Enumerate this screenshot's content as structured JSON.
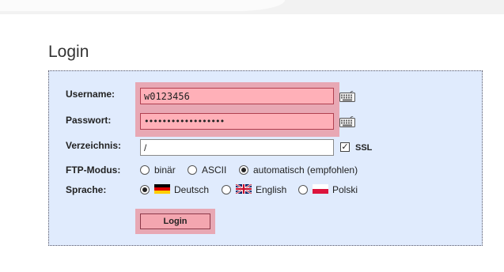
{
  "page": {
    "title": "Login"
  },
  "form": {
    "username_label": "Username:",
    "username_value": "w0123456",
    "password_label": "Passwort:",
    "password_value": "••••••••••••••••••",
    "directory_label": "Verzeichnis:",
    "directory_value": "/",
    "ssl_label": "SSL",
    "ssl_checked": "✓",
    "ftp_mode_label": "FTP-Modus:",
    "ftp_modes": [
      {
        "label": "binär",
        "selected": false
      },
      {
        "label": "ASCII",
        "selected": false
      },
      {
        "label": "automatisch (empfohlen)",
        "selected": true
      }
    ],
    "language_label": "Sprache:",
    "languages": [
      {
        "label": "Deutsch",
        "selected": true,
        "flag": "germany-flag-icon"
      },
      {
        "label": "English",
        "selected": false,
        "flag": "uk-flag-icon"
      },
      {
        "label": "Polski",
        "selected": false,
        "flag": "poland-flag-icon"
      }
    ],
    "login_button": "Login"
  },
  "colors": {
    "panel_bg": "#e0ebfd",
    "highlight": "#e8a8b4",
    "field_pink": "#ffb0b8"
  }
}
